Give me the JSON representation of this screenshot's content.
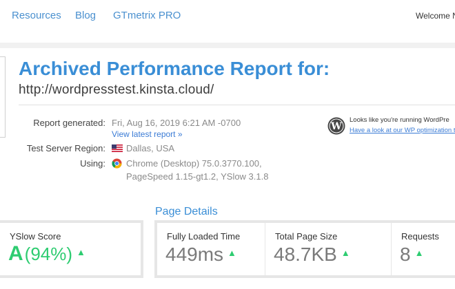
{
  "nav": {
    "links": [
      "Resources",
      "Blog",
      "GTmetrix PRO"
    ],
    "welcome": "Welcome N"
  },
  "report": {
    "title": "Archived Performance Report for:",
    "url": "http://wordpresstest.kinsta.cloud/",
    "generated_label": "Report generated:",
    "generated_value": "Fri, Aug 16, 2019 6:21 AM -0700",
    "view_latest": "View latest report »",
    "server_label": "Test Server Region:",
    "server_value": "Dallas, USA",
    "using_label": "Using:",
    "using_line1": "Chrome (Desktop) 75.0.3770.100,",
    "using_line2": "PageSpeed 1.15-gt1.2, YSlow 3.1.8"
  },
  "wordpress_notice": {
    "line1": "Looks like you're running WordPre",
    "line2": "Have a look at our WP optimization ti"
  },
  "page_details": {
    "title": "Page Details"
  },
  "yslow": {
    "label": "YSlow Score",
    "grade": "A",
    "percent": "(94%)"
  },
  "metrics": [
    {
      "label": "Fully Loaded Time",
      "value": "449ms"
    },
    {
      "label": "Total Page Size",
      "value": "48.7KB"
    },
    {
      "label": "Requests",
      "value": "8"
    }
  ],
  "colors": {
    "accent": "#3a8ed6",
    "good": "#2ecc71",
    "link": "#3a7bd5"
  },
  "icons": {
    "trend": "caret-up-icon",
    "flag": "us-flag-icon",
    "browser": "chrome-icon",
    "cms": "wordpress-icon"
  }
}
